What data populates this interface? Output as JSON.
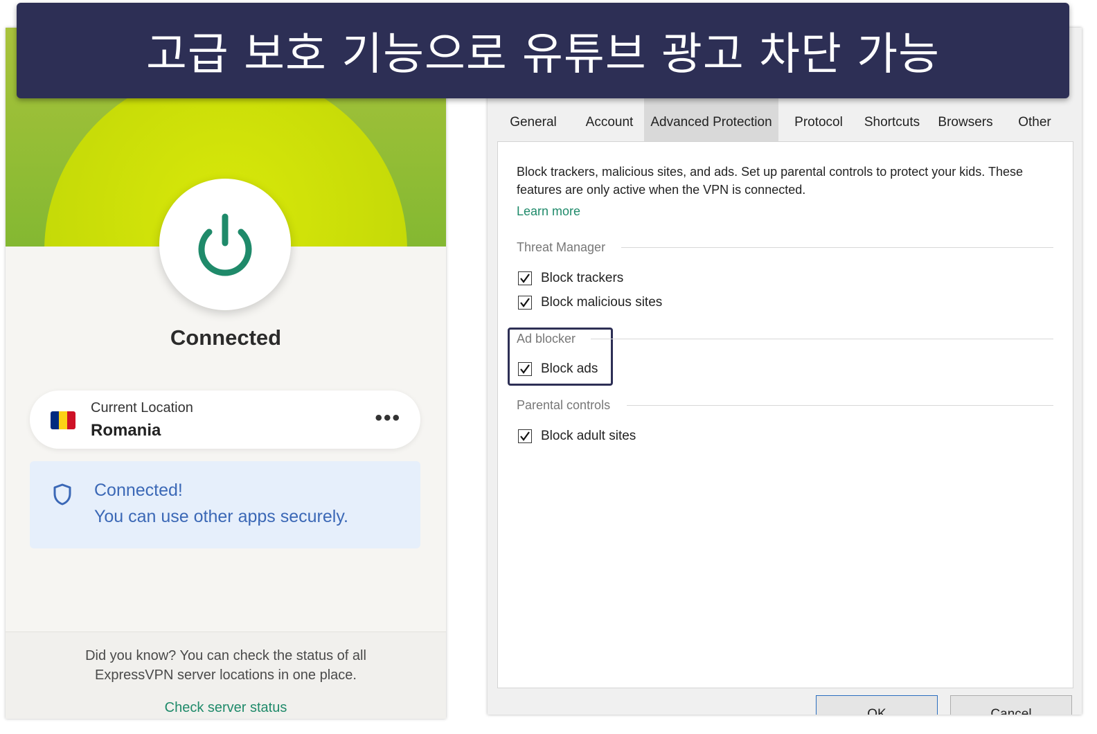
{
  "banner": {
    "title": "고급 보호 기능으로 유튜브 광고 차단 가능"
  },
  "vpn": {
    "status": "Connected",
    "location": {
      "caption": "Current Location",
      "name": "Romania",
      "flag_colors": [
        "#002b7f",
        "#fcd116",
        "#ce1126"
      ]
    },
    "notice": {
      "title": "Connected!",
      "subtitle": "You can use other apps securely."
    },
    "tip": {
      "line1": "Did you know? You can check the status of all",
      "line2": "ExpressVPN server locations in one place.",
      "link": "Check server status"
    },
    "accent": "#1f8a6a"
  },
  "settings": {
    "tabs": [
      "General",
      "Account",
      "Advanced Protection",
      "Protocol",
      "Shortcuts",
      "Browsers",
      "Other"
    ],
    "active_tab": "Advanced Protection",
    "description": "Block trackers, malicious sites, and ads. Set up parental controls to protect your kids. These features are only active when the VPN is connected.",
    "learn_more": "Learn more",
    "sections": {
      "threat_manager": {
        "title": "Threat Manager",
        "options": [
          {
            "label": "Block trackers",
            "checked": true
          },
          {
            "label": "Block malicious sites",
            "checked": true
          }
        ]
      },
      "ad_blocker": {
        "title": "Ad blocker",
        "options": [
          {
            "label": "Block ads",
            "checked": true
          }
        ]
      },
      "parental": {
        "title": "Parental controls",
        "options": [
          {
            "label": "Block adult sites",
            "checked": true
          }
        ]
      }
    },
    "buttons": {
      "ok": "OK",
      "cancel": "Cancel"
    }
  }
}
